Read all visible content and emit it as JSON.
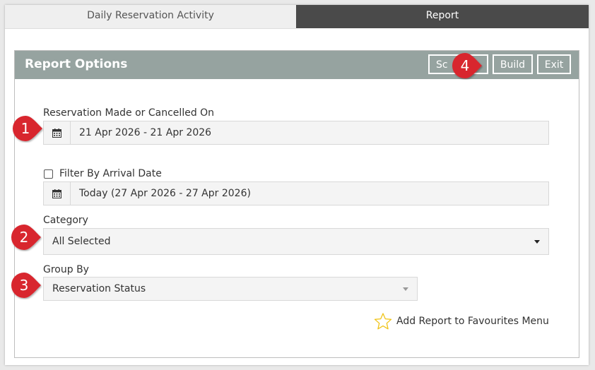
{
  "tabs": [
    {
      "label": "Daily Reservation Activity",
      "active": false
    },
    {
      "label": "Report",
      "active": true
    }
  ],
  "panel": {
    "title": "Report Options",
    "buttons": {
      "schedule": "Sc",
      "build": "Build",
      "exit": "Exit"
    }
  },
  "reservation_date": {
    "label": "Reservation Made or Cancelled On",
    "value": "21 Apr 2026 - 21 Apr 2026",
    "icon": "calendar-icon"
  },
  "arrival_filter": {
    "label": "Filter By Arrival Date",
    "checked": false,
    "value": "Today (27 Apr 2026 - 27 Apr 2026)",
    "icon": "calendar-icon"
  },
  "category": {
    "label": "Category",
    "value": "All Selected"
  },
  "group_by": {
    "label": "Group By",
    "value": "Reservation Status"
  },
  "favourites": {
    "label": "Add Report to Favourites Menu",
    "icon": "star-icon"
  },
  "markers": [
    "1",
    "2",
    "3",
    "4"
  ],
  "colors": {
    "header": "#96a3a0",
    "active_tab": "#4a4a4a",
    "marker": "#d8252f",
    "star": "#f0c419"
  }
}
